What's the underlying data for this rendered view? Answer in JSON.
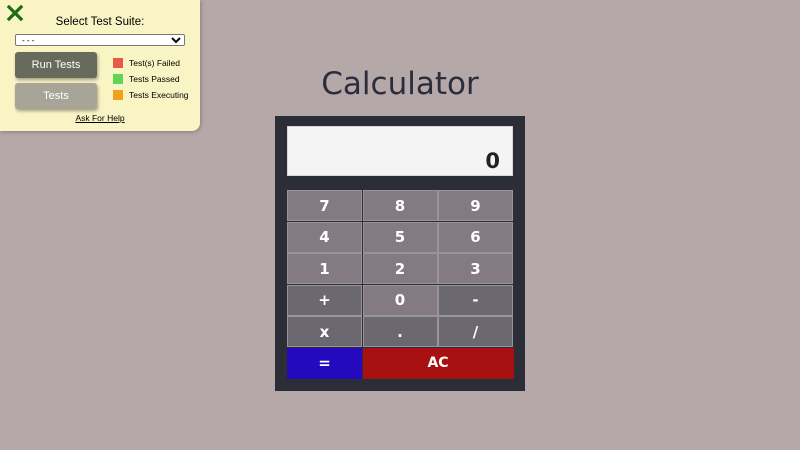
{
  "panel": {
    "suite_label": "Select Test Suite:",
    "suite_selected": "- - -",
    "run_tests_label": "Run Tests",
    "tests_label": "Tests",
    "legend": [
      {
        "label": "Test(s) Failed",
        "color": "#e85a45"
      },
      {
        "label": "Tests Passed",
        "color": "#5fd65a"
      },
      {
        "label": "Tests Executing",
        "color": "#f0a01c"
      }
    ],
    "help_label": "Ask For Help"
  },
  "calculator": {
    "title": "Calculator",
    "display": "0",
    "keys": [
      {
        "label": "7",
        "kind": "digit"
      },
      {
        "label": "8",
        "kind": "digit"
      },
      {
        "label": "9",
        "kind": "digit"
      },
      {
        "label": "4",
        "kind": "digit"
      },
      {
        "label": "5",
        "kind": "digit"
      },
      {
        "label": "6",
        "kind": "digit"
      },
      {
        "label": "1",
        "kind": "digit"
      },
      {
        "label": "2",
        "kind": "digit"
      },
      {
        "label": "3",
        "kind": "digit"
      },
      {
        "label": "+",
        "kind": "op"
      },
      {
        "label": "0",
        "kind": "digit"
      },
      {
        "label": "-",
        "kind": "op"
      },
      {
        "label": "x",
        "kind": "op"
      },
      {
        "label": ".",
        "kind": "op"
      },
      {
        "label": "/",
        "kind": "op"
      },
      {
        "label": "=",
        "kind": "equals"
      },
      {
        "label": "AC",
        "kind": "clear"
      }
    ],
    "colors": {
      "equals": "#2409bf",
      "clear": "#a81111"
    }
  }
}
